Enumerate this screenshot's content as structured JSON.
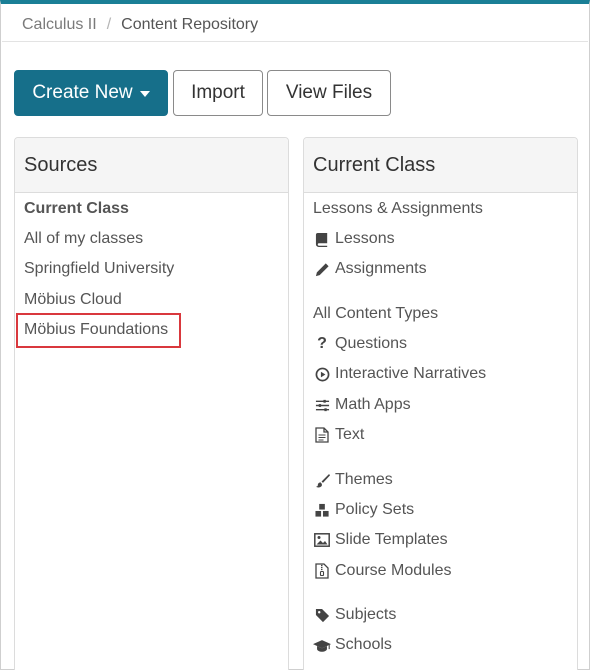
{
  "breadcrumb": {
    "course": "Calculus II",
    "separator": "/",
    "current": "Content Repository"
  },
  "toolbar": {
    "create_new_label": "Create New",
    "import_label": "Import",
    "view_files_label": "View Files"
  },
  "sources": {
    "title": "Sources",
    "items": [
      "Current Class",
      "All of my classes",
      "Springfield University",
      "Möbius Cloud",
      "Möbius Foundations"
    ],
    "selected": "Current Class",
    "highlighted": "Möbius Foundations"
  },
  "current_class": {
    "title": "Current Class",
    "section1_heading": "Lessons & Assignments",
    "lessons": "Lessons",
    "assignments": "Assignments",
    "section2_heading": "All Content Types",
    "questions": "Questions",
    "interactive_narratives": "Interactive Narratives",
    "math_apps": "Math Apps",
    "text": "Text",
    "themes": "Themes",
    "policy_sets": "Policy Sets",
    "slide_templates": "Slide Templates",
    "course_modules": "Course Modules",
    "subjects": "Subjects",
    "schools": "Schools"
  },
  "colors": {
    "accent": "#1a7f96",
    "primary_button": "#166f8a",
    "highlight": "#d9383d"
  }
}
